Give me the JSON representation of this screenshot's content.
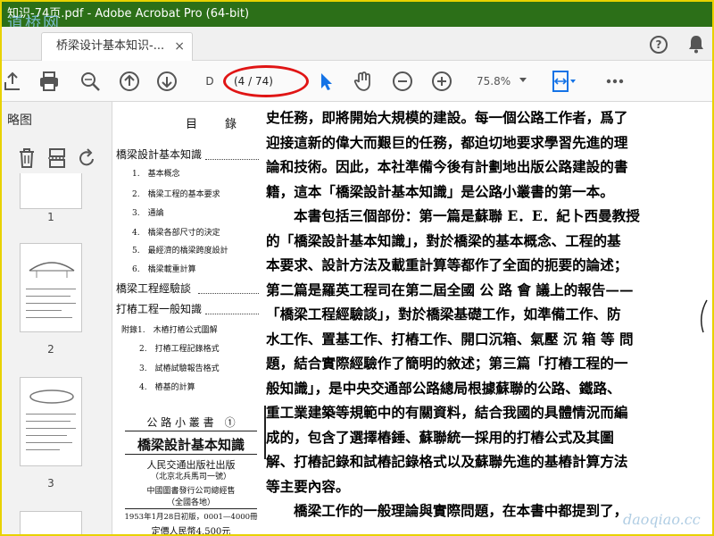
{
  "window": {
    "title": "知识-74页.pdf - Adobe Acrobat Pro (64-bit)",
    "watermark_top": "道桥网",
    "watermark_bottom": "daoqiao.cc"
  },
  "tabs": [
    {
      "label": "桥梁设计基本知识-...",
      "close": "×"
    }
  ],
  "header_icons": [
    "help-icon",
    "bell-icon"
  ],
  "toolbar": {
    "page_prefix": "D",
    "page_display": "(4 / 74)",
    "zoom": "75.8%",
    "icons": [
      "share-icon",
      "print-icon",
      "zoom-search-icon",
      "prev-page-icon",
      "next-page-icon",
      "select-cursor-icon",
      "hand-icon",
      "zoom-out-icon",
      "zoom-in-icon",
      "fit-page-icon",
      "more-icon"
    ]
  },
  "left_panel": {
    "title": "略图",
    "thumbnails": [
      {
        "number": "1"
      },
      {
        "number": "2"
      },
      {
        "number": "3"
      }
    ]
  },
  "toc": {
    "heading_left": "目",
    "heading_right": "錄",
    "sections": [
      {
        "title": "橋梁設計基本知識",
        "items": [
          "1.　基本概念",
          "2.　橋梁工程的基本要求",
          "3.　通論",
          "4.　橋梁各部尺寸的決定",
          "5.　最經濟的橋梁跨度設計",
          "6.　橋梁載重計算"
        ]
      },
      {
        "title": "橋梁工程經驗談",
        "items": []
      },
      {
        "title": "打樁工程一般知識",
        "items": [
          "附錄1.　木樁打樁公式圖解",
          "2.　打樁工程記錄格式",
          "3.　試樁試驗報告格式",
          "4.　樁基的計算"
        ]
      }
    ]
  },
  "cover": {
    "series": "公 路 小 叢 書　①",
    "title": "橋梁設計基本知識",
    "publisher": "人民交通出版社出版",
    "address": "（北京北兵馬司一號）",
    "distributor": "中國圖書發行公司總經售",
    "distributor_note": "（全國各地）",
    "edition": "1953年1月28日初版，0001—4000冊",
    "price": "定價人民幣4,500元"
  },
  "body": [
    {
      "text": "史任務，即將開始大規模的建設。每一個公路工作者，爲了",
      "indent": false
    },
    {
      "text": "迎接這新的偉大而艱巨的任務，都迫切地要求學習先進的理",
      "indent": false
    },
    {
      "text": "論和技術。因此，本社準備今後有計劃地出版公路建設的書",
      "indent": false
    },
    {
      "text": "籍，這本「橋梁設計基本知識」是公路小叢書的第一本。",
      "indent": false
    },
    {
      "text": "本書包括三個部份：第一篇是蘇聯 E．E．紀卜西曼教授",
      "indent": true
    },
    {
      "text": "的「橋梁設計基本知識」，對於橋梁的基本概念、工程的基",
      "indent": false
    },
    {
      "text": "本要求、設計方法及載重計算等都作了全面的扼要的論述；",
      "indent": false
    },
    {
      "text": "第二篇是羅英工程司在第二屆全國 公 路 會 議上的報告——",
      "indent": false
    },
    {
      "text": "「橋梁工程經驗談」，對於橋梁基礎工作，如準備工作、防",
      "indent": false
    },
    {
      "text": "水工作、置基工作、打樁工作、開口沉箱、氣壓 沉 箱 等 問",
      "indent": false
    },
    {
      "text": "題，結合實際經驗作了簡明的敘述；第三篇「打樁工程的一",
      "indent": false
    },
    {
      "text": "般知識」，是中央交通部公路總局根據蘇聯的公路、鐵路、",
      "indent": false
    },
    {
      "text": "重工業建築等規範中的有關資料，結合我國的具體情況而編",
      "indent": false
    },
    {
      "text": "成的，包含了選擇樁錘、蘇聯統一採用的打樁公式及其圖",
      "indent": false
    },
    {
      "text": "解、打樁記錄和試樁記錄格式以及蘇聯先進的基樁計算方法",
      "indent": false
    },
    {
      "text": "等主要內容。",
      "indent": false
    },
    {
      "text": "橋梁工作的一般理論與實際問題，在本書中都提到了，",
      "indent": true
    }
  ],
  "colors": {
    "title_bar": "#2c6f18",
    "frame_border": "#e8d200",
    "highlight_ellipse": "#e01515",
    "select_tool": "#1473e6"
  }
}
